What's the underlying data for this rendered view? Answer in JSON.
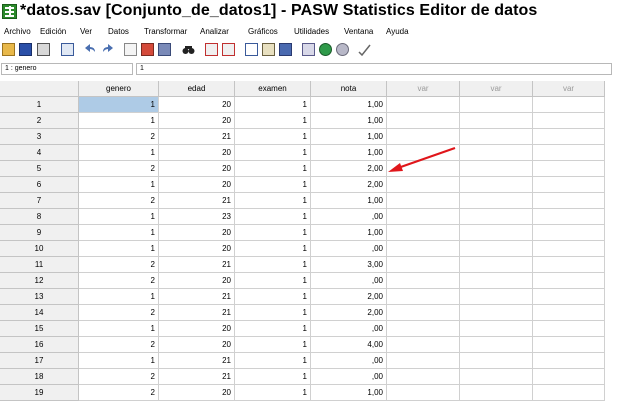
{
  "window": {
    "title": "*datos.sav [Conjunto_de_datos1] - PASW Statistics Editor de datos"
  },
  "menu": [
    "Archivo",
    "Edición",
    "Ver",
    "Datos",
    "Transformar",
    "Analizar",
    "Gráficos",
    "Utilidades",
    "Ventana",
    "Ayuda"
  ],
  "toolbar": {
    "icons": [
      "open-folder-icon",
      "save-icon",
      "print-icon",
      "dialog-recall-icon",
      "undo-icon",
      "redo-icon",
      "goto-case-icon",
      "goto-variable-icon",
      "variables-icon",
      "find-icon",
      "insert-cases-icon",
      "insert-variable-icon",
      "split-file-icon",
      "weight-cases-icon",
      "select-cases-icon",
      "value-labels-icon",
      "use-sets-icon",
      "show-all-variables-icon",
      "spell-check-icon"
    ]
  },
  "cellbar": {
    "ref": "1 : genero",
    "value": "1"
  },
  "grid": {
    "columns": [
      "genero",
      "edad",
      "examen",
      "nota",
      "var",
      "var",
      "var"
    ],
    "rows": [
      [
        "1",
        "1",
        "20",
        "1",
        "1,00"
      ],
      [
        "2",
        "1",
        "20",
        "1",
        "1,00"
      ],
      [
        "3",
        "2",
        "21",
        "1",
        "1,00"
      ],
      [
        "4",
        "1",
        "20",
        "1",
        "1,00"
      ],
      [
        "5",
        "2",
        "20",
        "1",
        "2,00"
      ],
      [
        "6",
        "1",
        "20",
        "1",
        "2,00"
      ],
      [
        "7",
        "2",
        "21",
        "1",
        "1,00"
      ],
      [
        "8",
        "1",
        "23",
        "1",
        ",00"
      ],
      [
        "9",
        "1",
        "20",
        "1",
        "1,00"
      ],
      [
        "10",
        "1",
        "20",
        "1",
        ",00"
      ],
      [
        "11",
        "2",
        "21",
        "1",
        "3,00"
      ],
      [
        "12",
        "2",
        "20",
        "1",
        ",00"
      ],
      [
        "13",
        "1",
        "21",
        "1",
        "2,00"
      ],
      [
        "14",
        "2",
        "21",
        "1",
        "2,00"
      ],
      [
        "15",
        "1",
        "20",
        "1",
        ",00"
      ],
      [
        "16",
        "2",
        "20",
        "1",
        "4,00"
      ],
      [
        "17",
        "1",
        "21",
        "1",
        ",00"
      ],
      [
        "18",
        "2",
        "21",
        "1",
        ",00"
      ],
      [
        "19",
        "2",
        "20",
        "1",
        "1,00"
      ]
    ],
    "selected": {
      "row": 0,
      "col": 0
    },
    "empty_header_color": "#9a9a9a",
    "selected_color": "#aecbe6"
  },
  "annotation": {
    "arrow_color": "#e0161b"
  }
}
